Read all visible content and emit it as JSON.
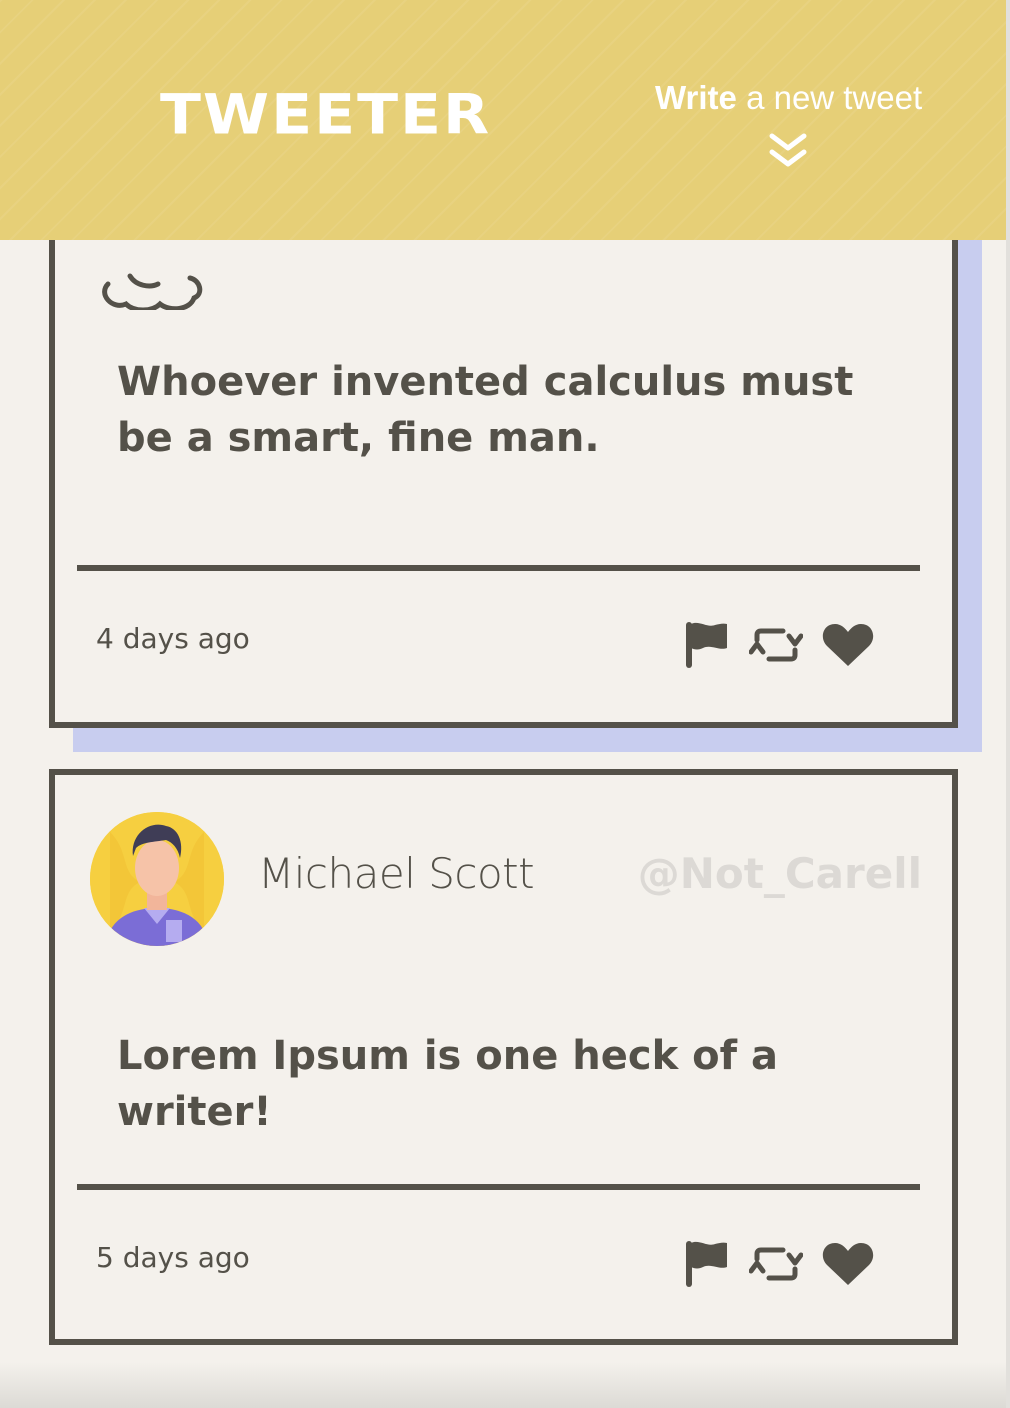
{
  "nav": {
    "brand": "TWEETER",
    "compose_bold": "Write",
    "compose_rest": " a new tweet",
    "compose_icon": "chevrons-down-icon"
  },
  "tweets": [
    {
      "avatar": "alien-avatar",
      "name": "",
      "handle": "",
      "content": "Whoever invented calculus must be a smart, fine man.",
      "time": "4 days ago",
      "actions": [
        "flag-icon",
        "retweet-icon",
        "heart-icon"
      ]
    },
    {
      "avatar": "person-avatar",
      "name": "Michael Scott",
      "handle": "@Not_Carell",
      "content": "Lorem Ipsum is one heck of a writer!",
      "time": "5 days ago",
      "actions": [
        "flag-icon",
        "retweet-icon",
        "heart-icon"
      ]
    }
  ],
  "colors": {
    "nav_bg": "#e6cf77",
    "text": "#545149",
    "page_bg": "#f4f1ec",
    "shadow": "#c8cdef",
    "handle": "#dcd9d5",
    "avatar_bg": "#f6cf40"
  }
}
